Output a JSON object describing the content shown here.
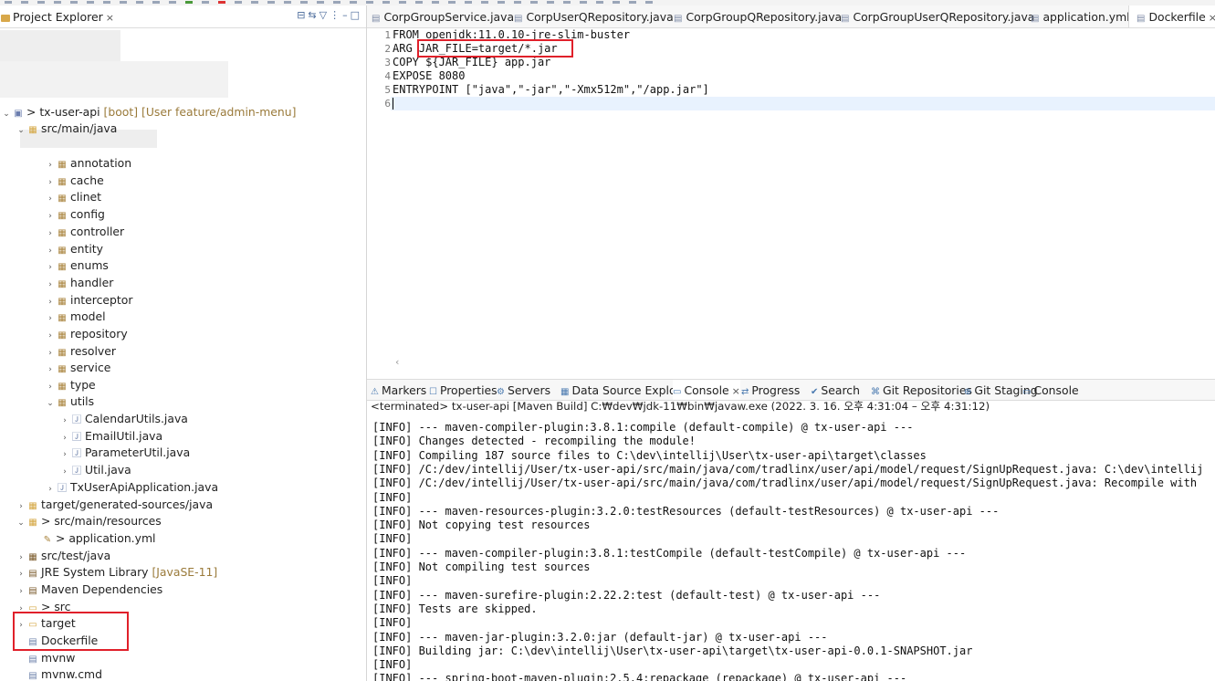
{
  "explorer": {
    "tab_label": "Project Explorer",
    "tab_close": "×",
    "tree": [
      {
        "id": "proj",
        "indent": 0,
        "twisty": "⌄",
        "icon": "▣",
        "icon_class": "proj",
        "label": "> tx-user-api",
        "suffix": " [boot] [User feature/admin-menu]"
      },
      {
        "id": "srcmain",
        "indent": 1,
        "twisty": "⌄",
        "icon": "▦",
        "icon_class": "fold",
        "label": "src/main/java",
        "suffix": ""
      },
      {
        "id": "annotation",
        "indent": 3,
        "twisty": "›",
        "icon": "▦",
        "icon_class": "pkg",
        "label": "annotation",
        "suffix": ""
      },
      {
        "id": "cache",
        "indent": 3,
        "twisty": "›",
        "icon": "▦",
        "icon_class": "pkg",
        "label": "cache",
        "suffix": ""
      },
      {
        "id": "clinet",
        "indent": 3,
        "twisty": "›",
        "icon": "▦",
        "icon_class": "pkg",
        "label": "clinet",
        "suffix": ""
      },
      {
        "id": "config",
        "indent": 3,
        "twisty": "›",
        "icon": "▦",
        "icon_class": "pkg",
        "label": "config",
        "suffix": ""
      },
      {
        "id": "controller",
        "indent": 3,
        "twisty": "›",
        "icon": "▦",
        "icon_class": "pkg",
        "label": "controller",
        "suffix": ""
      },
      {
        "id": "entity",
        "indent": 3,
        "twisty": "›",
        "icon": "▦",
        "icon_class": "pkg",
        "label": "entity",
        "suffix": ""
      },
      {
        "id": "enums",
        "indent": 3,
        "twisty": "›",
        "icon": "▦",
        "icon_class": "pkg",
        "label": "enums",
        "suffix": ""
      },
      {
        "id": "handler",
        "indent": 3,
        "twisty": "›",
        "icon": "▦",
        "icon_class": "pkg",
        "label": "handler",
        "suffix": ""
      },
      {
        "id": "interceptor",
        "indent": 3,
        "twisty": "›",
        "icon": "▦",
        "icon_class": "pkg",
        "label": "interceptor",
        "suffix": ""
      },
      {
        "id": "model",
        "indent": 3,
        "twisty": "›",
        "icon": "▦",
        "icon_class": "pkg",
        "label": "model",
        "suffix": ""
      },
      {
        "id": "repository",
        "indent": 3,
        "twisty": "›",
        "icon": "▦",
        "icon_class": "pkg",
        "label": "repository",
        "suffix": ""
      },
      {
        "id": "resolver",
        "indent": 3,
        "twisty": "›",
        "icon": "▦",
        "icon_class": "pkg",
        "label": "resolver",
        "suffix": ""
      },
      {
        "id": "service",
        "indent": 3,
        "twisty": "›",
        "icon": "▦",
        "icon_class": "pkg",
        "label": "service",
        "suffix": ""
      },
      {
        "id": "type",
        "indent": 3,
        "twisty": "›",
        "icon": "▦",
        "icon_class": "pkg",
        "label": "type",
        "suffix": ""
      },
      {
        "id": "utils",
        "indent": 3,
        "twisty": "⌄",
        "icon": "▦",
        "icon_class": "pkg",
        "label": "utils",
        "suffix": ""
      },
      {
        "id": "calendar",
        "indent": 4,
        "twisty": "›",
        "icon": "🄹",
        "icon_class": "jf",
        "label": "CalendarUtils.java",
        "suffix": ""
      },
      {
        "id": "email",
        "indent": 4,
        "twisty": "›",
        "icon": "🄹",
        "icon_class": "jf",
        "label": "EmailUtil.java",
        "suffix": ""
      },
      {
        "id": "param",
        "indent": 4,
        "twisty": "›",
        "icon": "🄹",
        "icon_class": "jf",
        "label": "ParameterUtil.java",
        "suffix": ""
      },
      {
        "id": "util",
        "indent": 4,
        "twisty": "›",
        "icon": "🄹",
        "icon_class": "jf",
        "label": "Util.java",
        "suffix": ""
      },
      {
        "id": "app",
        "indent": 3,
        "twisty": "›",
        "icon": "🄹",
        "icon_class": "jf",
        "label": "TxUserApiApplication.java",
        "suffix": ""
      },
      {
        "id": "gen",
        "indent": 1,
        "twisty": "›",
        "icon": "▦",
        "icon_class": "fold",
        "label": "target/generated-sources/java",
        "suffix": ""
      },
      {
        "id": "res",
        "indent": 1,
        "twisty": "⌄",
        "icon": "▦",
        "icon_class": "fold",
        "label": "> src/main/resources",
        "suffix": ""
      },
      {
        "id": "yml",
        "indent": 2,
        "twisty": "",
        "icon": "✎",
        "icon_class": "pkg",
        "label": "> application.yml",
        "suffix": ""
      },
      {
        "id": "test",
        "indent": 1,
        "twisty": "›",
        "icon": "▦",
        "icon_class": "lib",
        "label": "src/test/java",
        "suffix": ""
      },
      {
        "id": "jre",
        "indent": 1,
        "twisty": "›",
        "icon": "▤",
        "icon_class": "lib",
        "label": "JRE System Library",
        "suffix": " [JavaSE-11]"
      },
      {
        "id": "maven",
        "indent": 1,
        "twisty": "›",
        "icon": "▤",
        "icon_class": "lib",
        "label": "Maven Dependencies",
        "suffix": ""
      },
      {
        "id": "src",
        "indent": 1,
        "twisty": "›",
        "icon": "▭",
        "icon_class": "fold",
        "label": "> src",
        "suffix": ""
      },
      {
        "id": "target",
        "indent": 1,
        "twisty": "›",
        "icon": "▭",
        "icon_class": "fold",
        "label": "target",
        "suffix": ""
      },
      {
        "id": "dockerfile",
        "indent": 1,
        "twisty": "",
        "icon": "▤",
        "icon_class": "jf",
        "label": "Dockerfile",
        "suffix": ""
      },
      {
        "id": "mvnw",
        "indent": 1,
        "twisty": "",
        "icon": "▤",
        "icon_class": "jf",
        "label": "mvnw",
        "suffix": ""
      },
      {
        "id": "mvnwcmd",
        "indent": 1,
        "twisty": "",
        "icon": "▤",
        "icon_class": "jf",
        "label": "mvnw.cmd",
        "suffix": ""
      }
    ]
  },
  "editor": {
    "tabs": [
      {
        "label": "CorpGroupService.java",
        "active": false
      },
      {
        "label": "CorpUserQRepository.java",
        "active": false
      },
      {
        "label": "CorpGroupQRepository.java",
        "active": false
      },
      {
        "label": "CorpGroupUserQRepository.java",
        "active": false
      },
      {
        "label": "application.yml",
        "active": false
      },
      {
        "label": "Dockerfile",
        "active": true
      }
    ],
    "lines": [
      "FROM openjdk:11.0.10-jre-slim-buster",
      "ARG JAR_FILE=target/*.jar",
      "COPY ${JAR_FILE} app.jar",
      "EXPOSE 8080",
      "ENTRYPOINT [\"java\",\"-jar\",\"-Xmx512m\",\"/app.jar\"]",
      ""
    ]
  },
  "console": {
    "tabs": [
      "Markers",
      "Properties",
      "Servers",
      "Data Source Explorer",
      "Console",
      "Progress",
      "Search",
      "Git Repositories",
      "Git Staging",
      "Console"
    ],
    "active_tab": 4,
    "status": "<terminated> tx-user-api [Maven Build] C:₩dev₩jdk-11₩bin₩javaw.exe  (2022. 3. 16. 오후 4:31:04 – 오후 4:31:12)",
    "lines": [
      "[INFO] --- maven-compiler-plugin:3.8.1:compile (default-compile) @ tx-user-api ---",
      "[INFO] Changes detected - recompiling the module!",
      "[INFO] Compiling 187 source files to C:\\dev\\intellij\\User\\tx-user-api\\target\\classes",
      "[INFO] /C:/dev/intellij/User/tx-user-api/src/main/java/com/tradlinx/user/api/model/request/SignUpRequest.java: C:\\dev\\intellij",
      "[INFO] /C:/dev/intellij/User/tx-user-api/src/main/java/com/tradlinx/user/api/model/request/SignUpRequest.java: Recompile with",
      "[INFO]",
      "[INFO] --- maven-resources-plugin:3.2.0:testResources (default-testResources) @ tx-user-api ---",
      "[INFO] Not copying test resources",
      "[INFO]",
      "[INFO] --- maven-compiler-plugin:3.8.1:testCompile (default-testCompile) @ tx-user-api ---",
      "[INFO] Not compiling test sources",
      "[INFO]",
      "[INFO] --- maven-surefire-plugin:2.22.2:test (default-test) @ tx-user-api ---",
      "[INFO] Tests are skipped.",
      "[INFO]",
      "[INFO] --- maven-jar-plugin:3.2.0:jar (default-jar) @ tx-user-api ---",
      "[INFO] Building jar: C:\\dev\\intellij\\User\\tx-user-api\\target\\tx-user-api-0.0.1-SNAPSHOT.jar",
      "[INFO]",
      "[INFO] --- spring-boot-maven-plugin:2.5.4:repackage (repackage) @ tx-user-api ---"
    ]
  },
  "colors": {
    "highlight_box": "#e0202a",
    "current_line": "#e8f2fe"
  }
}
